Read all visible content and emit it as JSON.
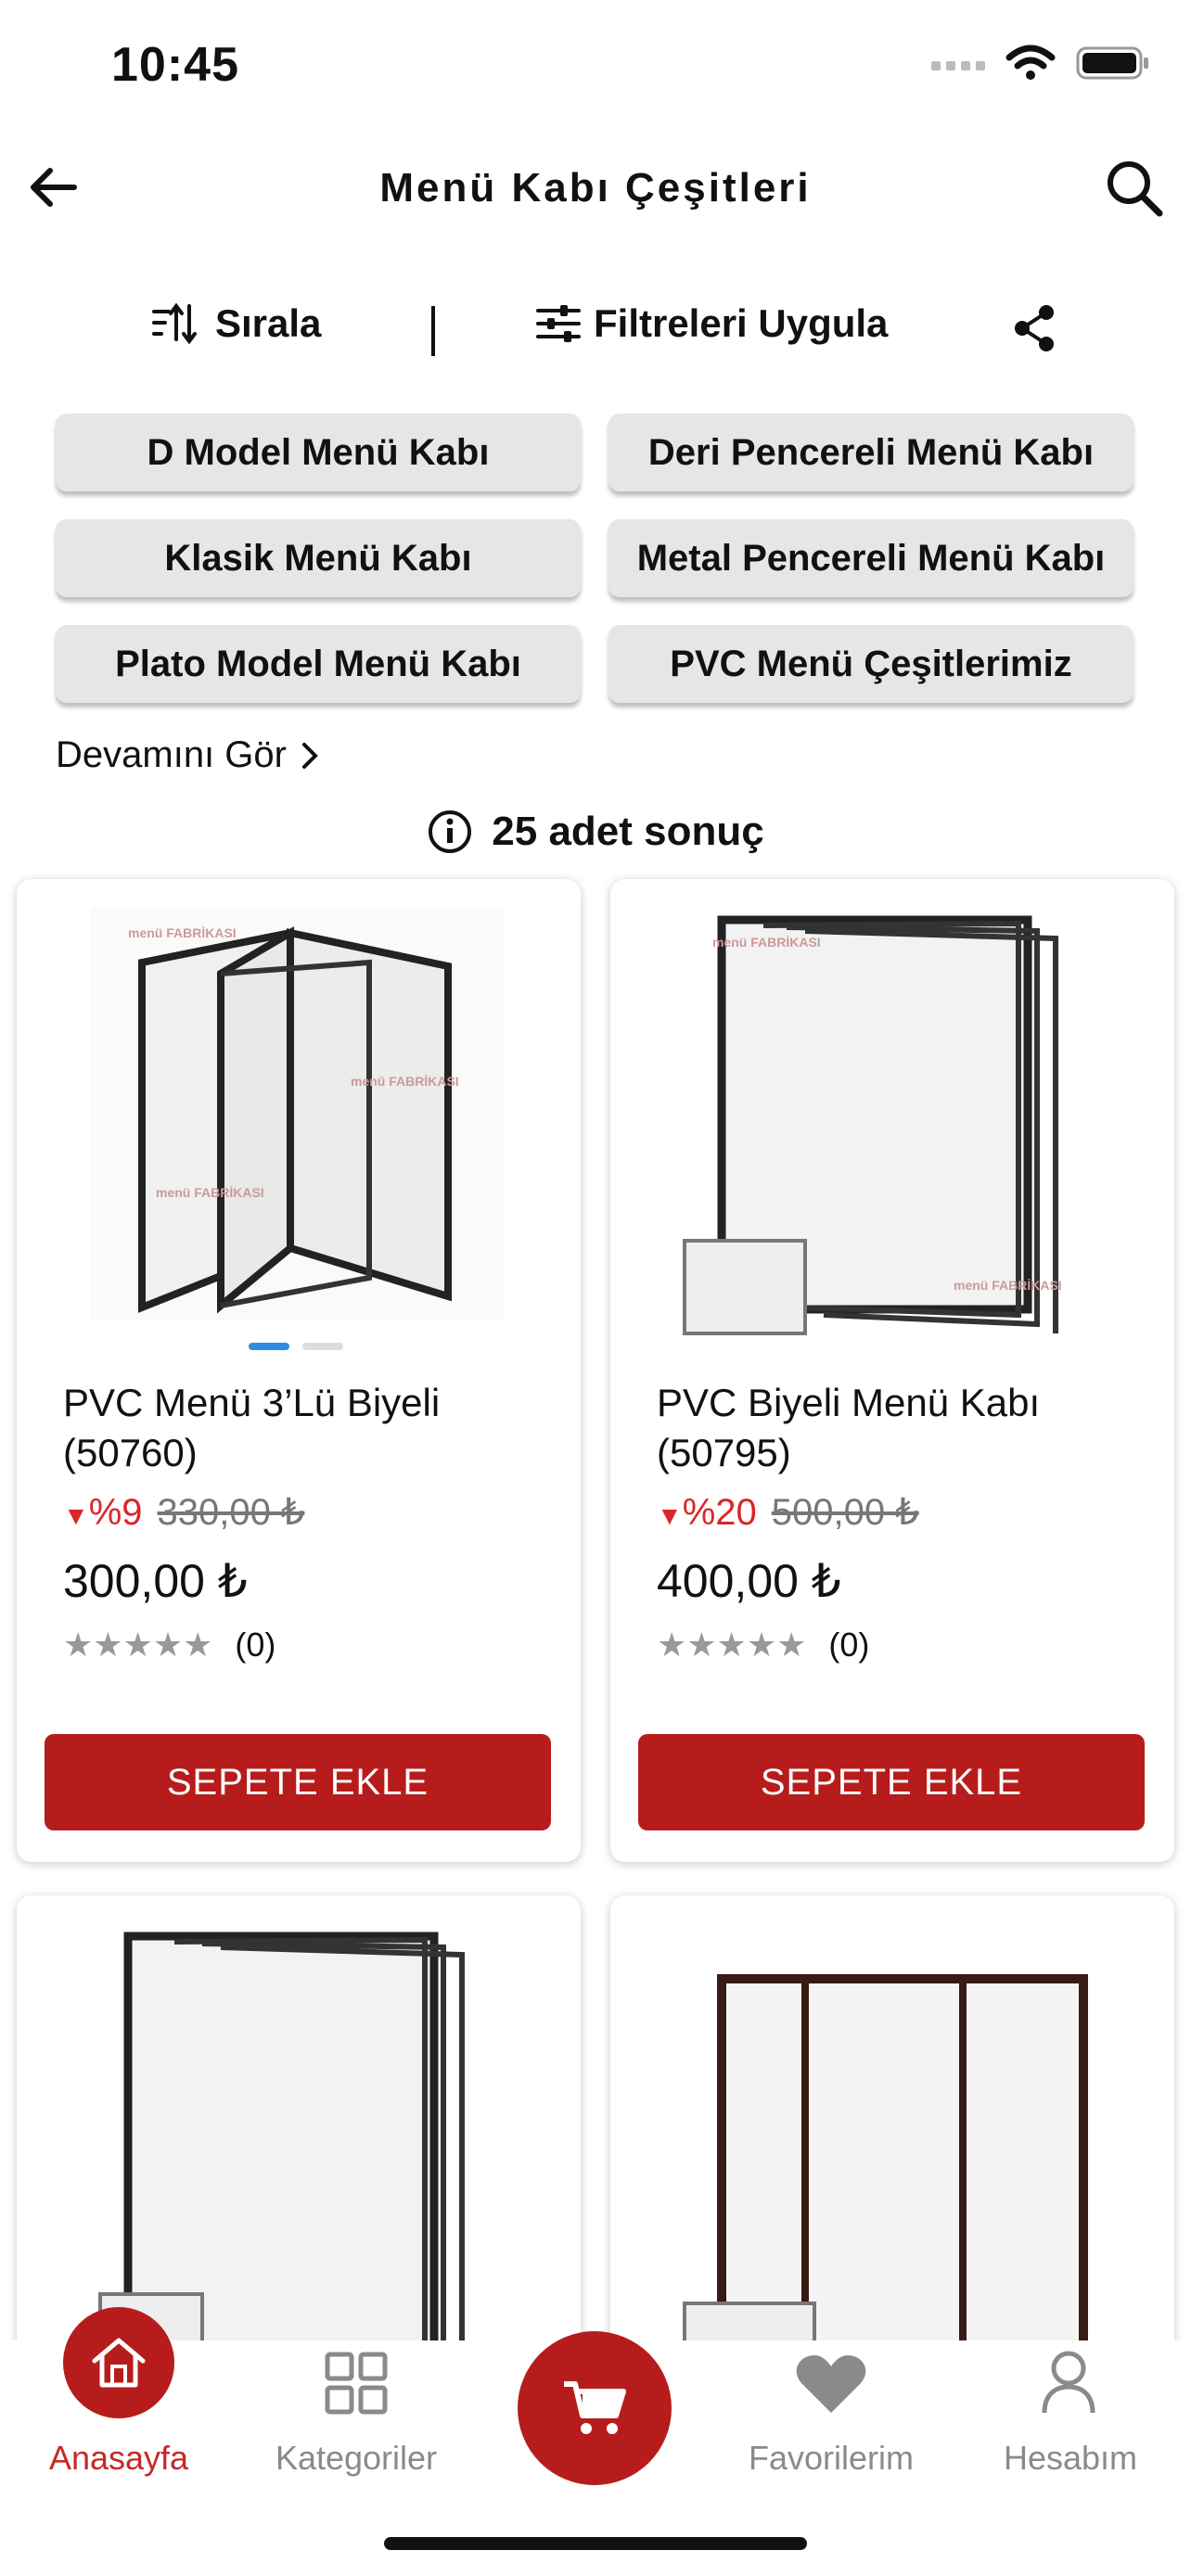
{
  "status_bar": {
    "time": "10:45"
  },
  "header": {
    "title": "Menü Kabı Çeşitleri"
  },
  "toolbar": {
    "sort_label": "Sırala",
    "filter_label": "Filtreleri Uygula"
  },
  "categories": [
    "D Model Menü Kabı",
    "Deri Pencereli Menü Kabı",
    "Klasik Menü Kabı",
    "Metal Pencereli Menü Kabı",
    "Plato Model Menü Kabı",
    "PVC Menü Çeşitlerimiz"
  ],
  "more_label": "Devamını Gör",
  "result_text": "25 adet sonuç",
  "products": [
    {
      "name": "PVC Menü 3’Lü Biyeli (50760)",
      "discount": "%9",
      "old_price": "330,00 ₺",
      "price": "300,00 ₺",
      "stars": "★★★★★",
      "reviews": "(0)",
      "button": "SEPETE EKLE",
      "watermark": "menü FABRİKASI"
    },
    {
      "name": "PVC Biyeli Menü Kabı (50795)",
      "discount": "%20",
      "old_price": "500,00 ₺",
      "price": "400,00 ₺",
      "stars": "★★★★★",
      "reviews": "(0)",
      "button": "SEPETE EKLE",
      "watermark": "menü FABRİKASI"
    }
  ],
  "bottom_nav": {
    "home": "Anasayfa",
    "categories": "Kategoriler",
    "favorites": "Favorilerim",
    "account": "Hesabım"
  },
  "colors": {
    "brand": "#b71c1c",
    "discount": "#d9262a",
    "chip_bg": "#e6e6e6"
  }
}
